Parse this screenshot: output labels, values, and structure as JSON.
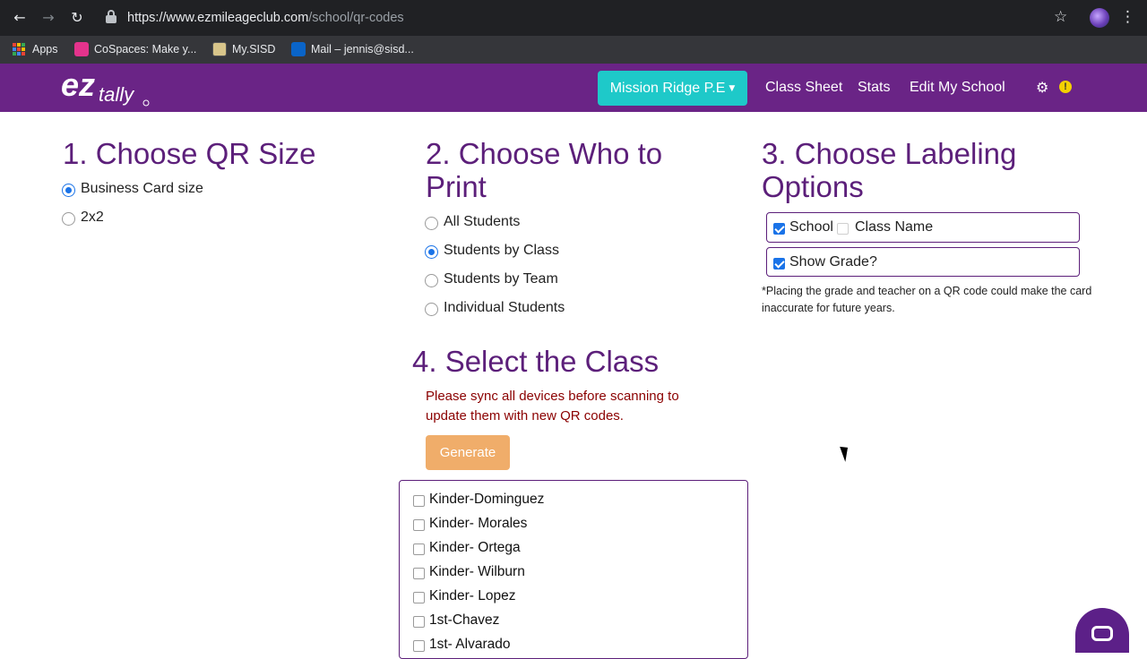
{
  "browser": {
    "url_host": "https://www.ezmileageclub.com",
    "url_path": "/school/qr-codes",
    "bookmarks": [
      {
        "label": "Apps",
        "icon": "apps-grid-icon"
      },
      {
        "label": "CoSpaces: Make y...",
        "icon": "cospaces-icon"
      },
      {
        "label": "My.SISD",
        "icon": "sisd-icon"
      },
      {
        "label": "Mail – jennis@sisd...",
        "icon": "outlook-icon"
      }
    ]
  },
  "nav": {
    "logo_text": "eztally",
    "school_dropdown": "Mission Ridge P.E",
    "links": [
      "Class Sheet",
      "Stats",
      "Edit My School"
    ],
    "settings_icon": "gears-icon",
    "alert_icon": "exclamation-icon",
    "alert_glyph": "!"
  },
  "qr_size": {
    "heading": "1. Choose QR Size",
    "options": [
      {
        "label": "Business Card size",
        "selected": true
      },
      {
        "label": "2x2",
        "selected": false
      }
    ]
  },
  "who_to_print": {
    "heading": "2. Choose Who to Print",
    "options": [
      {
        "label": "All Students",
        "selected": false
      },
      {
        "label": "Students by Class",
        "selected": true
      },
      {
        "label": "Students by Team",
        "selected": false
      },
      {
        "label": "Individual Students",
        "selected": false
      }
    ]
  },
  "labeling": {
    "heading": "3. Choose Labeling Options",
    "options": [
      {
        "label": "School",
        "checked": true
      },
      {
        "label": "Class Name",
        "checked": false
      },
      {
        "label": "Show Grade?",
        "checked": true
      }
    ],
    "note": "*Placing the grade and teacher on a QR code could make the card inaccurate for future years."
  },
  "select_class": {
    "heading": "4. Select the Class",
    "warning": "Please sync all devices before scanning to update them with new QR codes.",
    "generate_label": "Generate",
    "classes": [
      {
        "label": "Kinder-Dominguez",
        "checked": false
      },
      {
        "label": "Kinder- Morales",
        "checked": false
      },
      {
        "label": "Kinder- Ortega",
        "checked": false
      },
      {
        "label": "Kinder- Wilburn",
        "checked": false
      },
      {
        "label": "Kinder- Lopez",
        "checked": false
      },
      {
        "label": "1st-Chavez",
        "checked": false
      },
      {
        "label": "1st- Alvarado",
        "checked": false
      }
    ]
  },
  "colors": {
    "brand_purple": "#6a2486",
    "heading_purple": "#5c1f7a",
    "teal": "#1ec9c9",
    "generate_orange": "#f0ad6a",
    "warning_red": "#8b0000"
  }
}
